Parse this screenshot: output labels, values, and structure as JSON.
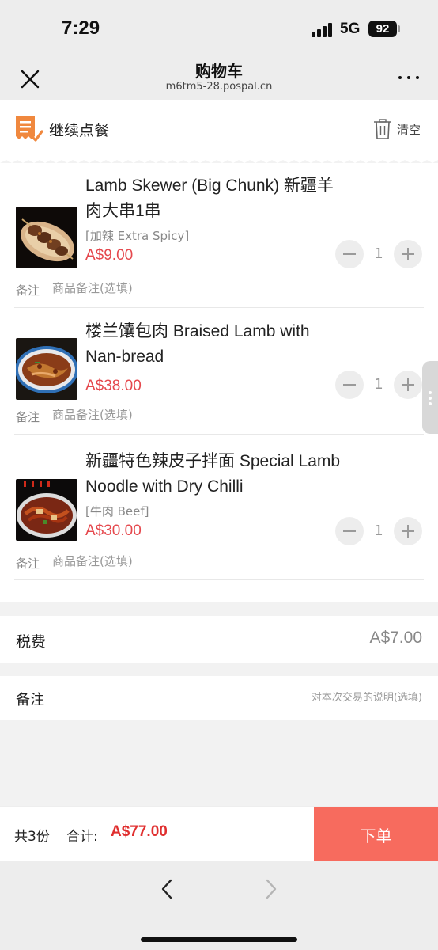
{
  "status_bar": {
    "time": "7:29",
    "network": "5G",
    "battery": "92"
  },
  "nav": {
    "title": "购物车",
    "subtitle": "m6tm5-28.pospal.cn",
    "close_icon": "close-icon",
    "more_icon": "more-dots-icon"
  },
  "toolbar": {
    "continue_label": "继续点餐",
    "clear_label": "清空"
  },
  "cart": {
    "items": [
      {
        "name": "Lamb Skewer (Big Chunk) 新疆羊肉大串1串",
        "option": "[加辣 Extra Spicy]",
        "price": "A$9.00",
        "quantity": "1",
        "note_label": "备注",
        "note_placeholder": "商品备注(选填)"
      },
      {
        "name": "楼兰馕包肉 Braised Lamb with Nan-bread",
        "option": "",
        "price": "A$38.00",
        "quantity": "1",
        "note_label": "备注",
        "note_placeholder": "商品备注(选填)"
      },
      {
        "name": "新疆特色辣皮子拌面 Special Lamb Noodle with Dry Chilli",
        "option": "[牛肉 Beef]",
        "price": "A$30.00",
        "quantity": "1",
        "note_label": "备注",
        "note_placeholder": "商品备注(选填)"
      }
    ]
  },
  "tax": {
    "label": "税费",
    "value": "A$7.00"
  },
  "remark": {
    "label": "备注",
    "placeholder": "对本次交易的说明(选填)"
  },
  "checkout": {
    "count_label": "共3份",
    "total_label": "合计:",
    "total_value": "A$77.00",
    "submit_label": "下单"
  },
  "colors": {
    "price": "#e5484d",
    "submit": "#f76b5e",
    "accent_orange": "#f0883e"
  }
}
